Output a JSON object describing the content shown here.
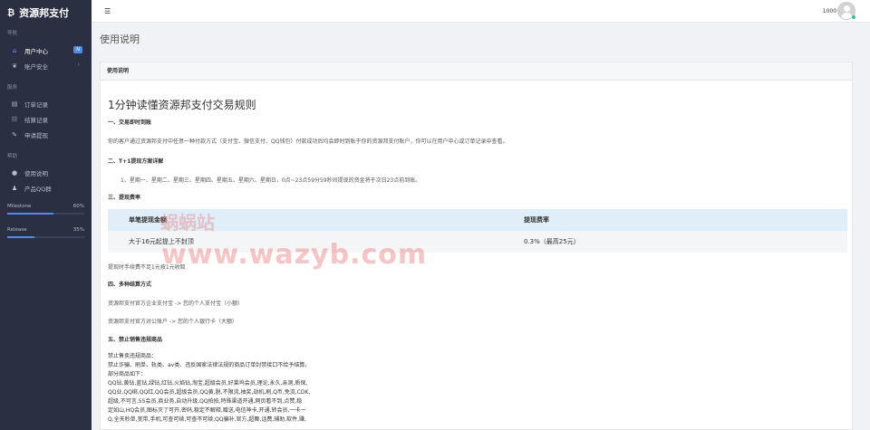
{
  "brand": {
    "logo_glyph": "₿",
    "name": "资源邦支付"
  },
  "sidebar": {
    "sections": [
      {
        "label": "导航"
      },
      {
        "label": "服务"
      },
      {
        "label": "帮助"
      }
    ],
    "items": [
      {
        "label": "用户中心",
        "icon": "home-icon",
        "glyph": "⌂",
        "badge": "N"
      },
      {
        "label": "账户安全",
        "icon": "leaf-icon",
        "glyph": "❦",
        "arrow": "›"
      },
      {
        "label": "订单记录",
        "icon": "order-icon",
        "glyph": "▤"
      },
      {
        "label": "结算记录",
        "icon": "list-icon",
        "glyph": "☷"
      },
      {
        "label": "申请提现",
        "icon": "edit-icon",
        "glyph": "✎"
      },
      {
        "label": "使用说明",
        "icon": "info-icon",
        "glyph": "●"
      },
      {
        "label": "产品QQ群",
        "icon": "qq-icon",
        "glyph": "♟"
      }
    ],
    "progress": [
      {
        "label": "Milestone",
        "value_text": "60%",
        "value": 0.6
      },
      {
        "label": "Release",
        "value_text": "35%",
        "value": 0.35
      }
    ]
  },
  "topbar": {
    "menu_glyph": "☰",
    "balance": "1000 ▾"
  },
  "page": {
    "title": "使用说明"
  },
  "card": {
    "header": "使用说明",
    "doc_title": "1分钟读懂资源邦支付交易规则",
    "sec1_title": "一、交易即时到账",
    "sec1_text": "你的客户通过资源邦支付中任意一种付款方式（支付宝、微信支付、QQ钱包）付款成功后均会即时到账于你的资源邦支付账户，你可以在用户中心或订单记录中查看。",
    "sec2_title": "二、T+1提现方案详解",
    "sec2_text": "1、星期一、星期二、星期三、星期四、星期五、星期六、星期日，0点~23点59分59秒间提现的资金将于次日23点前到账。",
    "sec3_title": "三、提现费率",
    "table": {
      "headers": [
        "单笔提现金额",
        "提现费率"
      ],
      "row": [
        "大于16元起提上不封顶",
        "0.3%（最高25元）"
      ]
    },
    "fee_note": "提现时手续费不足1元按1元收取",
    "sec4_title": "四、多种结算方式",
    "sec4_line1": "资源邦支付官方企业支付宝 -> 您的个人支付宝（小额）",
    "sec4_line2": "资源邦支付官方对公账户 -> 您的个人银行卡（大额）",
    "sec5_title": "五、禁止销售违规商品",
    "sec5_lines": [
      "禁止售卖违规商品：",
      "禁止诈骗、刷单、轨类、av类、违反国家法律法规的商品订单封禁接口不给予结算。",
      "部分商品如下：",
      "QQ钻,黄钻,蓝钻,绿钻,红钻,火焰钻,淘宝,超级会员,好莱坞会员,理论,永久,亲测,质保,",
      "QQ业,QQ绑,QQ红,QQ会员,超级会员,QQ黄,脱,不限流,抽奖,劫机,刷,Q币,免流,CDK,",
      "超级,不可言,55会员,商业务,自动升级,QQ拍拍,特殊渠道开通,网页看不到,点赞,稳",
      "定如山,HQ会员,图标灭了可开,密码,稳定不解释,赠送,电信神卡,开通,转会员,一卡一",
      "Q,全天秒单,宽带,手机,可查可续,可查不可续,QQ骗补,官方,超舞,话费,辅助,软件,赚,"
    ]
  },
  "watermark": {
    "cn": "蜗蜗站",
    "url": "www.wazyb.com"
  }
}
